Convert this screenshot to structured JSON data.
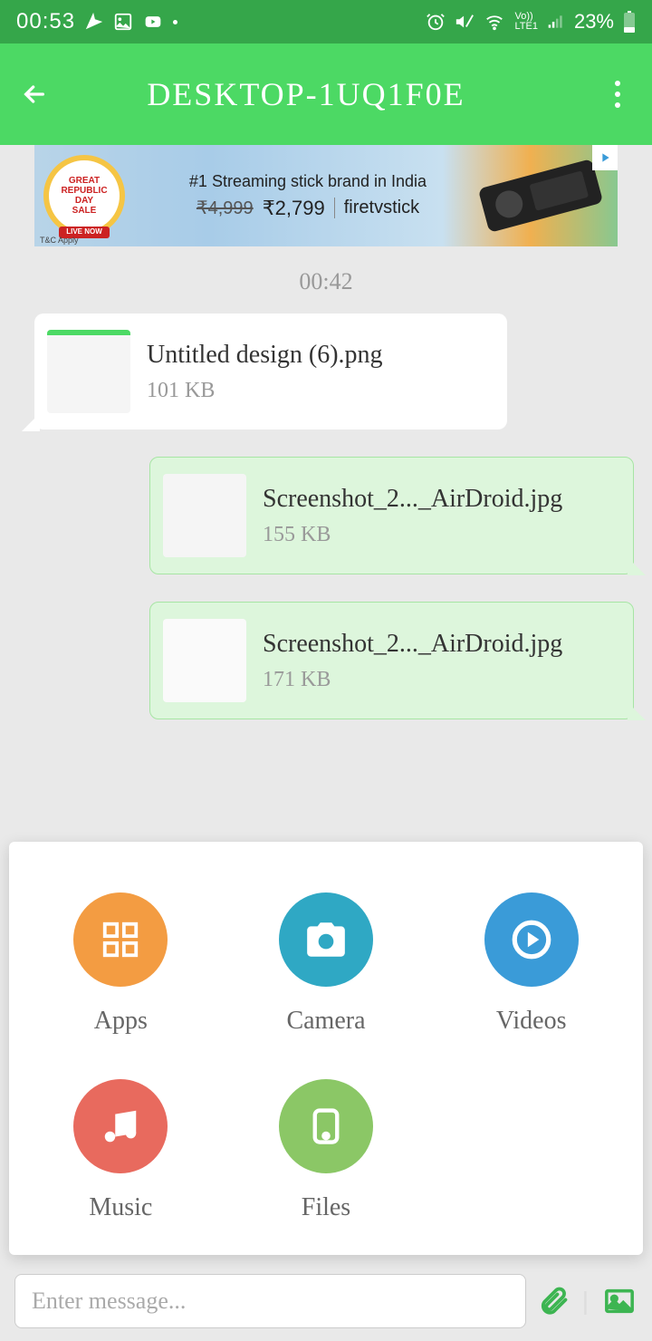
{
  "status": {
    "time": "00:53",
    "battery": "23%"
  },
  "header": {
    "title": "DESKTOP-1UQ1F0E"
  },
  "ad": {
    "badge_line1": "GREAT",
    "badge_line2": "REPUBLIC",
    "badge_line3": "DAY",
    "badge_line4": "SALE",
    "badge_live": "LIVE NOW",
    "tagline": "#1 Streaming stick brand in India",
    "old_price": "₹4,999",
    "new_price": "₹2,799",
    "brand": "firetvstick",
    "tc": "T&C Apply"
  },
  "chat": {
    "timestamp": "00:42",
    "messages": [
      {
        "name": "Untitled design (6).png",
        "size": "101 KB",
        "type": "received"
      },
      {
        "name": "Screenshot_2..._AirDroid.jpg",
        "size": "155 KB",
        "type": "sent"
      },
      {
        "name": "Screenshot_2..._AirDroid.jpg",
        "size": "171 KB",
        "type": "sent"
      }
    ]
  },
  "attach": {
    "apps": "Apps",
    "camera": "Camera",
    "videos": "Videos",
    "music": "Music",
    "files": "Files"
  },
  "input": {
    "placeholder": "Enter message..."
  }
}
